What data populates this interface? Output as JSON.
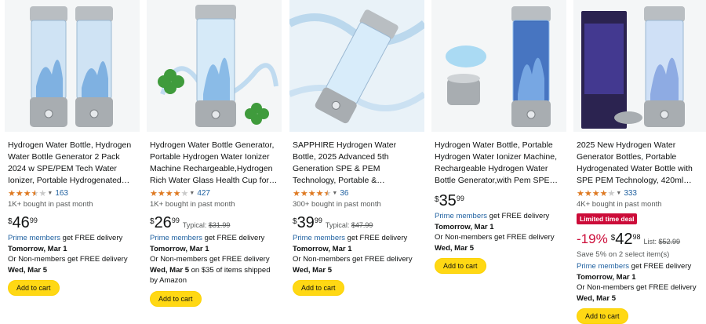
{
  "colors": {
    "star": "#de7921",
    "link": "#2162a1",
    "button": "#ffd814",
    "deal": "#cc0c39"
  },
  "products": [
    {
      "title": "Hydrogen Water Bottle, Hydrogen Water Bottle Generator 2 Pack 2024 w SPE/PEM Tech Water Ionizer, Portable Hydrogenated Water...",
      "rating": 3.5,
      "rating_count": "163",
      "bought": "1K+ bought in past month",
      "price": {
        "currency": "$",
        "whole": "46",
        "fraction": "99"
      },
      "delivery": {
        "prime_link": "Prime members",
        "prime_rest": " get FREE delivery",
        "date": "Tomorrow, Mar 1",
        "non_members": "Or Non-members get FREE delivery ",
        "non_members_date": "Wed, Mar 5"
      },
      "add_to_cart": "Add to cart"
    },
    {
      "title": "Hydrogen Water Bottle Generator, Portable Hydrogen Water Ionizer Machine Rechargeable,Hydrogen Rich Water Glass Health Cup for Travel...",
      "rating": 4.0,
      "rating_count": "427",
      "bought": "1K+ bought in past month",
      "price": {
        "currency": "$",
        "whole": "26",
        "fraction": "99",
        "typical_label": "Typical: ",
        "typical": "$31.99"
      },
      "delivery": {
        "prime_link": "Prime members",
        "prime_rest": " get FREE delivery",
        "date": "Tomorrow, Mar 1",
        "non_members": "Or Non-members get FREE delivery ",
        "non_members_date": "Wed, Mar 5",
        "non_members_tail": " on $35 of items shipped by Amazon"
      },
      "add_to_cart": "Add to cart"
    },
    {
      "title": "SAPPHIRE Hydrogen Water Bottle, 2025 Advanced 5th Generation SPE & PEM Technology, Portable & Rechargeable Hydrogen Water Bott...",
      "rating": 4.5,
      "rating_count": "36",
      "bought": "300+ bought in past month",
      "price": {
        "currency": "$",
        "whole": "39",
        "fraction": "99",
        "typical_label": "Typical: ",
        "typical": "$47.99"
      },
      "delivery": {
        "prime_link": "Prime members",
        "prime_rest": " get FREE delivery",
        "date": "Tomorrow, Mar 1",
        "non_members": "Or Non-members get FREE delivery ",
        "non_members_date": "Wed, Mar 5"
      },
      "add_to_cart": "Add to cart"
    },
    {
      "title": "Hydrogen Water Bottle, Portable Hydrogen Water Ionizer Machine, Rechargeable Hydrogen Water Bottle Generator,with Pem SPE Technolog...",
      "price": {
        "currency": "$",
        "whole": "35",
        "fraction": "99"
      },
      "delivery": {
        "prime_link": "Prime members",
        "prime_rest": " get FREE delivery",
        "date": "Tomorrow, Mar 1",
        "non_members": "Or Non-members get FREE delivery ",
        "non_members_date": "Wed, Mar 5"
      },
      "add_to_cart": "Add to cart"
    },
    {
      "title": "2025 New Hydrogen Water Generator Bottles, Portable Hydrogenated Water Bottle with SPE PEM Technology, 420ml Hydrogen...",
      "rating": 4.0,
      "rating_count": "333",
      "bought": "4K+ bought in past month",
      "deal_badge": "Limited time deal",
      "price": {
        "discount": "-19%",
        "currency": "$",
        "whole": "42",
        "fraction": "98",
        "list_label": "List: ",
        "list": "$52.99"
      },
      "save": "Save 5% on 2 select item(s)",
      "delivery": {
        "prime_link": "Prime members",
        "prime_rest": " get FREE delivery",
        "date": "Tomorrow, Mar 1",
        "non_members": "Or Non-members get FREE delivery ",
        "non_members_date": "Wed, Mar 5"
      },
      "add_to_cart": "Add to cart"
    }
  ]
}
